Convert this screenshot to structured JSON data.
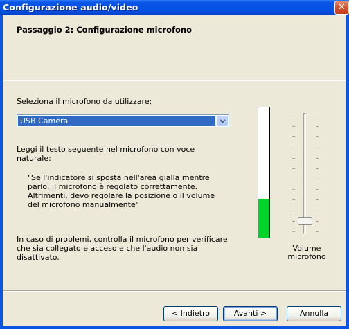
{
  "window": {
    "title": "Configurazione audio/video",
    "close_label": "✕"
  },
  "header": {
    "step_title": "Passaggio 2: Configurazione microfono"
  },
  "content": {
    "select_label": "Seleziona il microfono da utilizzare:",
    "microphone_selected": "USB Camera",
    "read_instruction_line1": "Leggi il testo seguente nel microfono con voce",
    "read_instruction_line2": "naturale:",
    "quote_lines": [
      "\"Se l'indicatore si sposta nell'area gialla mentre",
      "parlo, il microfono è regolato correttamente.",
      "Altrimenti, devo regolare la posizione o il volume",
      "del microfono manualmente\""
    ],
    "problem_lines": [
      "In caso di problemi, controlla il microfono per verificare",
      "che sia collegato e acceso e che l'audio non sia",
      "disattivato."
    ]
  },
  "meter": {
    "level_fraction": 0.3,
    "fill_color": "#00d42a"
  },
  "volume": {
    "label_line1": "Volume",
    "label_line2": "microfono",
    "level_fraction": 0.05
  },
  "buttons": {
    "back": "< Indietro",
    "next": "Avanti >",
    "cancel": "Annulla"
  }
}
